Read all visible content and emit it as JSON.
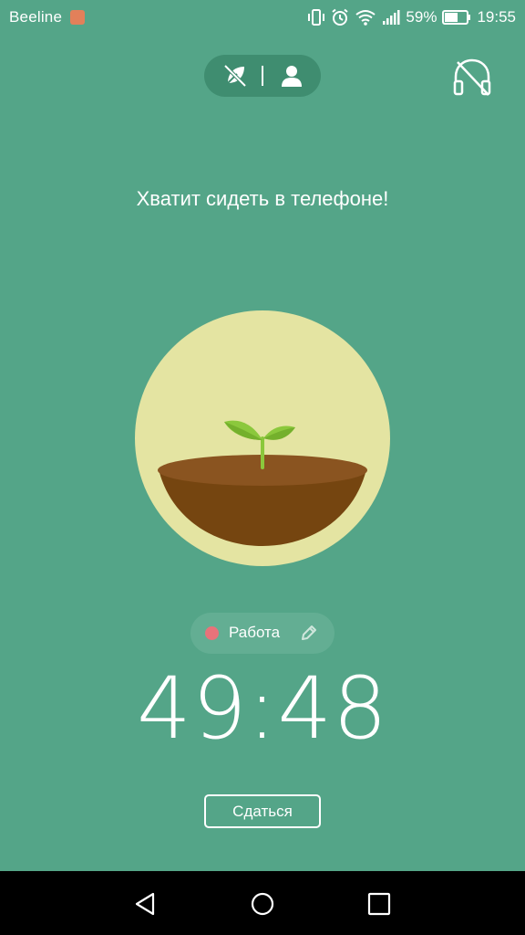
{
  "status_bar": {
    "carrier": "Beeline",
    "battery_percent": "59%",
    "time": "19:55",
    "icons": [
      "vibrate-icon",
      "alarm-icon",
      "wifi-icon",
      "signal-icon",
      "battery-icon"
    ]
  },
  "top_controls": {
    "left_icon": "no-leaf-icon",
    "right_icon": "person-icon",
    "sound_icon": "headphones-off-icon"
  },
  "headline": "Хватит сидеть в телефоне!",
  "tag": {
    "label": "Работа",
    "color": "#e8737a"
  },
  "timer": "49:48",
  "giveup_button": "Сдаться",
  "colors": {
    "background": "#54a588",
    "circle": "#e4e4a2",
    "soil": "#754510",
    "sprout": "#8bc83c"
  }
}
